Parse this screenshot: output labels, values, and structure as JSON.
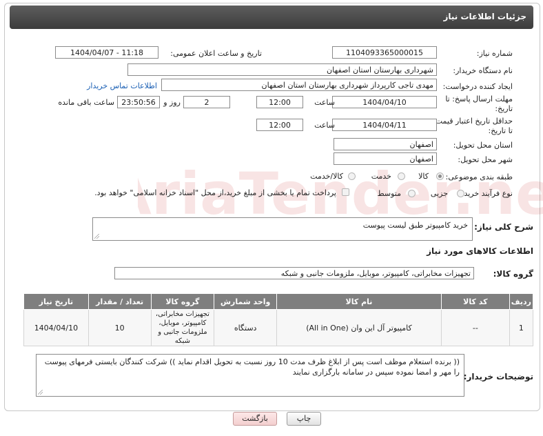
{
  "window": {
    "title": "جزئیات اطلاعات نیاز"
  },
  "fields": {
    "need_number_label": "شماره نیاز:",
    "need_number": "1104093365000015",
    "announce_label": "تاریخ و ساعت اعلان عمومی:",
    "announce_value": "1404/04/07 - 11:18",
    "buyer_org_label": "نام دستگاه خریدار:",
    "buyer_org": "شهرداری بهارستان استان اصفهان",
    "requester_label": "ایجاد کننده درخواست:",
    "requester": "مهدی تاجی کارپرداز شهرداری بهارستان استان اصفهان",
    "contact_link": "اطلاعات تماس خریدار",
    "deadline_label_1": "مهلت ارسال پاسخ: تا",
    "deadline_label_2": "تاریخ:",
    "deadline_date": "1404/04/10",
    "time_label": "ساعت",
    "deadline_time": "12:00",
    "days_value": "2",
    "days_label": "روز و",
    "remaining_time": "23:50:56",
    "remaining_label": "ساعت باقی مانده",
    "validity_label_1": "حداقل تاریخ اعتبار قیمت:",
    "validity_label_2": "تا تاریخ:",
    "validity_date": "1404/04/11",
    "validity_time": "12:00",
    "province_label": "استان محل تحویل:",
    "province": "اصفهان",
    "city_label": "شهر محل تحویل:",
    "city": "اصفهان",
    "category_label": "طبقه بندی موضوعی:",
    "category_options": [
      "کالا",
      "خدمت",
      "کالا/خدمت"
    ],
    "category_selected": "کالا",
    "process_label": "نوع فرآیند خرید :",
    "process_options": [
      "جزیی",
      "متوسط"
    ],
    "payment_note": "پرداخت تمام یا بخشی از مبلغ خرید،از محل \"اسناد خزانه اسلامی\" خواهد بود."
  },
  "description": {
    "label": "شرح کلی نیاز:",
    "text": "خرید کامپیوتر طبق لیست پیوست"
  },
  "goods_section": {
    "title": "اطلاعات کالاهای مورد نیاز",
    "group_label": "گروه کالا:",
    "group_value": "تجهیزات مخابراتی، کامپیوتر، موبایل، ملزومات جانبی و شبکه"
  },
  "table": {
    "headers": [
      "ردیف",
      "کد کالا",
      "نام کالا",
      "واحد شمارش",
      "گروه کالا",
      "تعداد / مقدار",
      "تاریخ نیاز"
    ],
    "rows": [
      [
        "1",
        "--",
        "کامپیوتر آل این وان (All in One)",
        "دستگاه",
        "تجهیزات مخابراتی، کامپیوتر، موبایل، ملزومات جانبی و شبکه",
        "10",
        "1404/04/10"
      ]
    ]
  },
  "buyer_notes": {
    "label": "توضیحات خریدار:",
    "text": "(( برنده استعلام موظف است پس از ابلاغ ظرف مدت 10 روز نسبت به تحویل اقدام نماید ))  شرکت کنندگان بایستی فرمهای پیوست را مهر و امضا نموده سپس در سامانه بارگزاری نمایند"
  },
  "buttons": {
    "print": "چاپ",
    "back": "بازگشت"
  },
  "watermark": "AriaTender.net"
}
